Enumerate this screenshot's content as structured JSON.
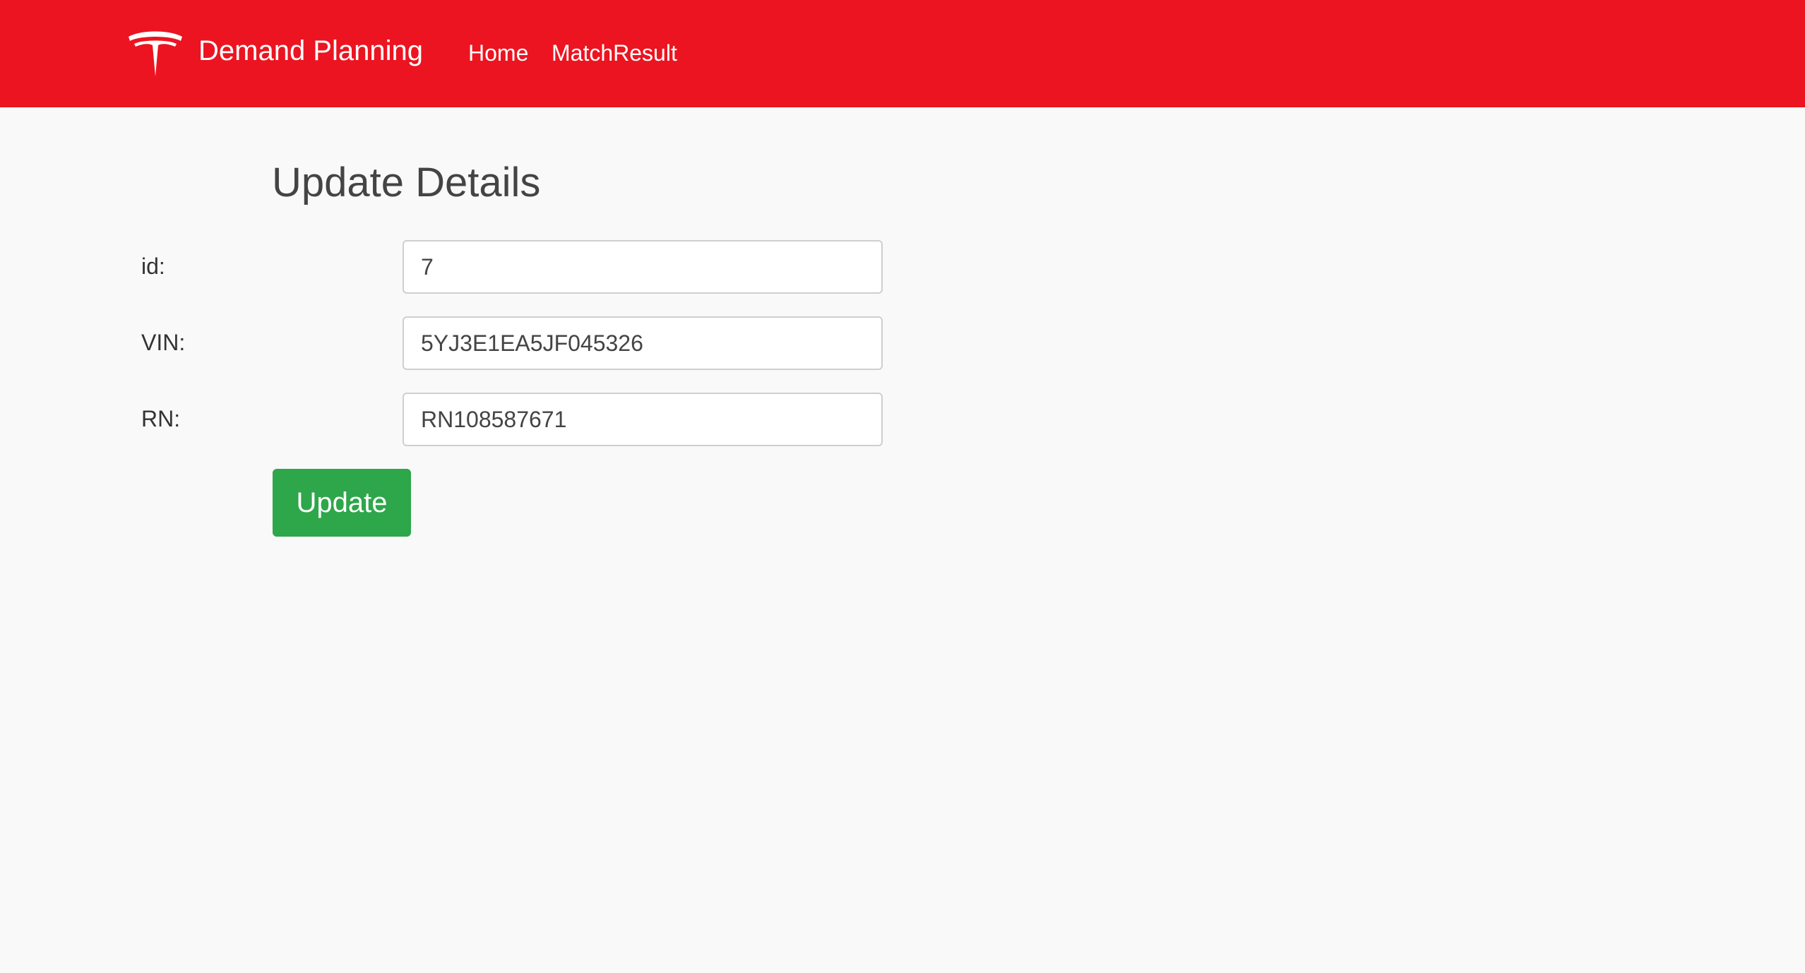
{
  "navbar": {
    "logo_icon": "tesla-t-logo-icon",
    "brand": "Demand Planning",
    "links": [
      "Home",
      "MatchResult"
    ],
    "background_color": "#ec1420"
  },
  "main": {
    "title": "Update Details",
    "fields": [
      {
        "label": "id:",
        "value": "7"
      },
      {
        "label": "VIN:",
        "value": "5YJ3E1EA5JF045326"
      },
      {
        "label": "RN:",
        "value": "RN108587671"
      }
    ],
    "submit_label": "Update",
    "submit_color": "#2ea64a"
  }
}
